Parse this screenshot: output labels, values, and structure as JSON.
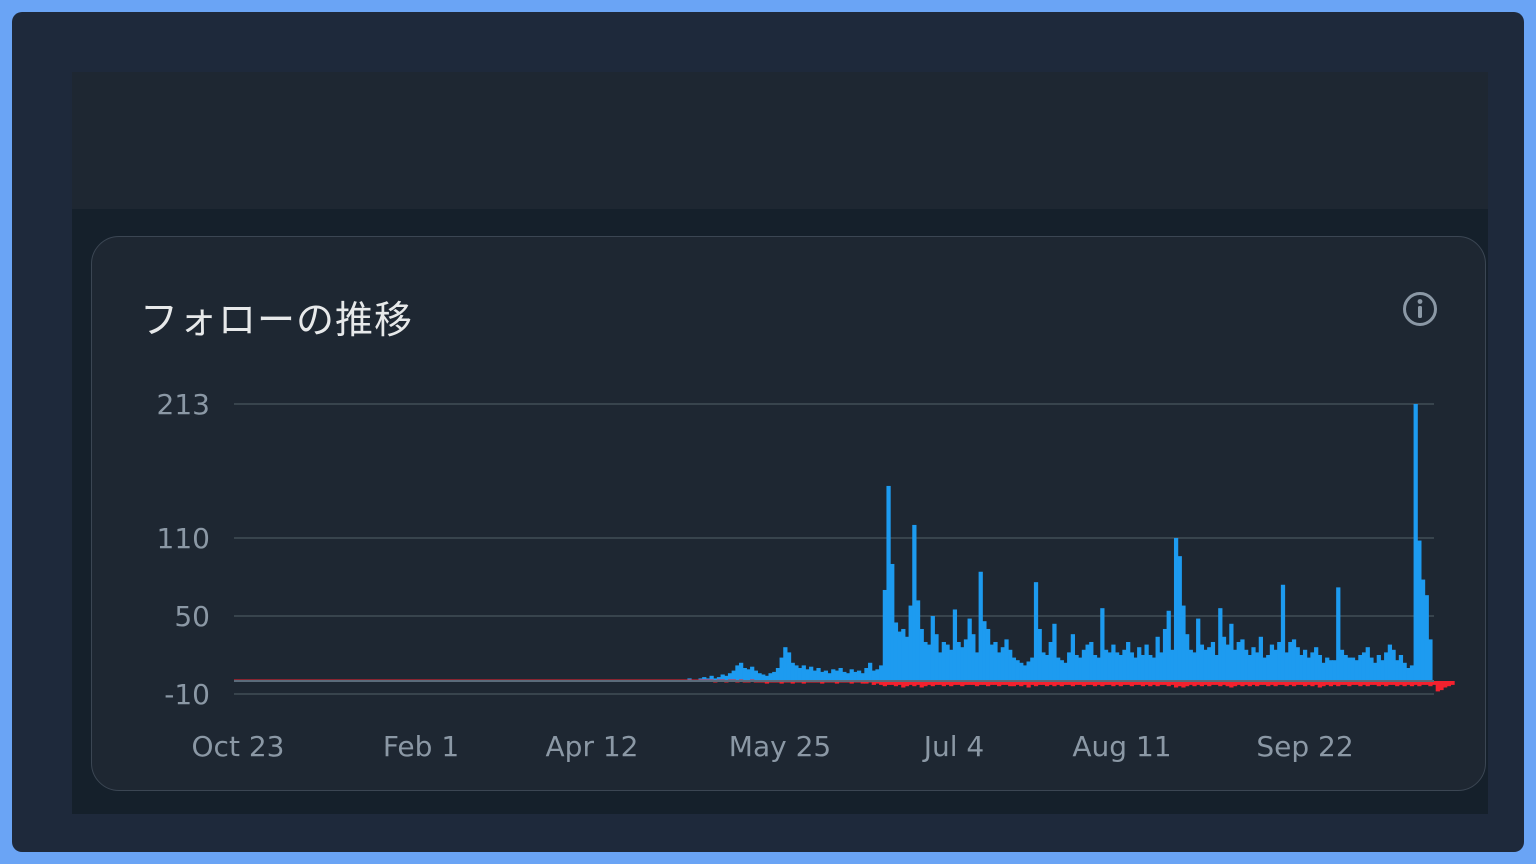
{
  "card": {
    "title": "フォローの推移",
    "info_icon": "info-circle-icon"
  },
  "colors": {
    "gained": "#1d9bf0",
    "lost": "#f4212e",
    "grid": "#38444d",
    "tick_text": "#8b98a5"
  },
  "chart_data": {
    "type": "bar",
    "title": "フォローの推移",
    "xlabel": "",
    "ylabel": "",
    "ylim": [
      -10,
      213
    ],
    "y_ticks": [
      "213",
      "110",
      "50",
      "-10"
    ],
    "x_ticks": [
      "Oct 23",
      "Feb 1",
      "Apr 12",
      "May 25",
      "Jul 4",
      "Aug 11",
      "Sep 22"
    ],
    "grid": true,
    "legend": "none",
    "x_range": [
      "Oct 23",
      "Oct 24"
    ],
    "series": [
      {
        "values": [
          0,
          0,
          0,
          0,
          0,
          0,
          0,
          0,
          0,
          0,
          0,
          0,
          0,
          0,
          0,
          0,
          0,
          0,
          0,
          0,
          0,
          0,
          0,
          0,
          0,
          1,
          0,
          0,
          0,
          0,
          0,
          0,
          0,
          0,
          0,
          0,
          0,
          0,
          0,
          0,
          1,
          0,
          0,
          0,
          0,
          0,
          0,
          0,
          0,
          0,
          0,
          0,
          0,
          0,
          0,
          0,
          0,
          0,
          0,
          0,
          0,
          0,
          0,
          0,
          0,
          0,
          0,
          0,
          0,
          0,
          0,
          0,
          0,
          0,
          0,
          0,
          0,
          0,
          0,
          0,
          0,
          0,
          0,
          0,
          0,
          0,
          0,
          0,
          0,
          0,
          0,
          0,
          0,
          0,
          0,
          0,
          0,
          0,
          0,
          0,
          0,
          0,
          0,
          0,
          0,
          0,
          0,
          0,
          0,
          0,
          0,
          0,
          1,
          0,
          0,
          0,
          1,
          0,
          1,
          1,
          0,
          1,
          1,
          2,
          1,
          1,
          2,
          3,
          2,
          4,
          2,
          3,
          5,
          4,
          6,
          8,
          12,
          14,
          10,
          9,
          11,
          8,
          6,
          5,
          4,
          6,
          7,
          10,
          18,
          26,
          22,
          14,
          12,
          10,
          12,
          9,
          11,
          8,
          10,
          7,
          8,
          6,
          9,
          8,
          10,
          7,
          6,
          9,
          7,
          8,
          6,
          10,
          14,
          8,
          9,
          12,
          70,
          150,
          90,
          45,
          38,
          40,
          34,
          58,
          120,
          62,
          40,
          30,
          28,
          50,
          36,
          22,
          30,
          28,
          24,
          55,
          30,
          26,
          32,
          48,
          36,
          22,
          84,
          46,
          40,
          28,
          30,
          22,
          26,
          32,
          24,
          18,
          16,
          14,
          12,
          15,
          18,
          76,
          40,
          22,
          20,
          30,
          44,
          18,
          16,
          14,
          22,
          36,
          20,
          18,
          24,
          28,
          30,
          20,
          18,
          56,
          24,
          22,
          28,
          22,
          20,
          24,
          30,
          22,
          18,
          26,
          20,
          28,
          20,
          18,
          34,
          22,
          40,
          54,
          24,
          110,
          96,
          58,
          36,
          24,
          22,
          48,
          28,
          24,
          26,
          30,
          20,
          56,
          34,
          28,
          44,
          24,
          30,
          32,
          24,
          20,
          26,
          22,
          34,
          18,
          20,
          28,
          24,
          30,
          74,
          22,
          30,
          32,
          26,
          20,
          24,
          18,
          22,
          26,
          20,
          14,
          18,
          16,
          16,
          72,
          24,
          20,
          18,
          18,
          16,
          20,
          22,
          26,
          18,
          14,
          20,
          16,
          22,
          28,
          24,
          16,
          20,
          14,
          10,
          12,
          213,
          108,
          78,
          66,
          32
        ],
        "color": "#1d9bf0"
      },
      {
        "values": [
          0,
          0,
          0,
          0,
          0,
          0,
          0,
          0,
          0,
          0,
          0,
          0,
          0,
          0,
          0,
          0,
          0,
          0,
          0,
          0,
          0,
          0,
          0,
          0,
          0,
          0,
          0,
          0,
          0,
          0,
          0,
          0,
          0,
          0,
          0,
          0,
          0,
          0,
          0,
          0,
          0,
          0,
          0,
          0,
          0,
          0,
          0,
          0,
          0,
          0,
          0,
          0,
          0,
          0,
          0,
          0,
          0,
          0,
          0,
          0,
          0,
          0,
          0,
          0,
          0,
          0,
          0,
          0,
          0,
          0,
          0,
          0,
          0,
          0,
          0,
          0,
          0,
          0,
          0,
          0,
          0,
          0,
          0,
          0,
          0,
          0,
          0,
          0,
          0,
          0,
          0,
          0,
          0,
          0,
          0,
          0,
          0,
          0,
          0,
          0,
          0,
          0,
          0,
          0,
          0,
          0,
          0,
          0,
          0,
          0,
          0,
          0,
          0,
          0,
          0,
          0,
          0,
          0,
          0,
          0,
          0,
          0,
          0,
          0,
          0,
          0,
          0,
          0,
          0,
          0,
          -1,
          0,
          0,
          -1,
          0,
          0,
          -1,
          0,
          -1,
          -1,
          0,
          -1,
          -1,
          -1,
          -2,
          -1,
          -1,
          -1,
          -2,
          -1,
          -1,
          -2,
          -1,
          -1,
          -2,
          -1,
          -1,
          -1,
          -1,
          -2,
          -1,
          -1,
          -1,
          -2,
          -1,
          -1,
          -1,
          -2,
          -1,
          -1,
          -2,
          -2,
          -1,
          -3,
          -2,
          -3,
          -4,
          -3,
          -3,
          -4,
          -3,
          -5,
          -4,
          -3,
          -4,
          -3,
          -5,
          -4,
          -3,
          -4,
          -3,
          -3,
          -4,
          -3,
          -4,
          -3,
          -3,
          -4,
          -3,
          -3,
          -3,
          -4,
          -3,
          -3,
          -4,
          -3,
          -3,
          -4,
          -3,
          -3,
          -4,
          -4,
          -3,
          -4,
          -3,
          -5,
          -3,
          -4,
          -3,
          -3,
          -4,
          -3,
          -4,
          -3,
          -4,
          -3,
          -3,
          -4,
          -3,
          -3,
          -4,
          -3,
          -3,
          -4,
          -3,
          -4,
          -3,
          -3,
          -4,
          -3,
          -4,
          -3,
          -3,
          -4,
          -3,
          -3,
          -4,
          -3,
          -4,
          -3,
          -4,
          -3,
          -3,
          -4,
          -3,
          -5,
          -4,
          -5,
          -4,
          -3,
          -4,
          -3,
          -4,
          -3,
          -4,
          -3,
          -3,
          -4,
          -3,
          -4,
          -5,
          -4,
          -3,
          -4,
          -3,
          -4,
          -3,
          -4,
          -3,
          -3,
          -4,
          -3,
          -4,
          -3,
          -3,
          -4,
          -3,
          -4,
          -3,
          -3,
          -4,
          -3,
          -4,
          -3,
          -5,
          -4,
          -3,
          -4,
          -3,
          -4,
          -3,
          -3,
          -4,
          -3,
          -3,
          -4,
          -3,
          -4,
          -3,
          -3,
          -4,
          -3,
          -4,
          -3,
          -3,
          -4,
          -3,
          -4,
          -3,
          -4,
          -3,
          -4,
          -3,
          -3,
          -4,
          -3,
          -8,
          -7,
          -5,
          -4,
          -3
        ],
        "color": "#f4212e"
      }
    ]
  }
}
